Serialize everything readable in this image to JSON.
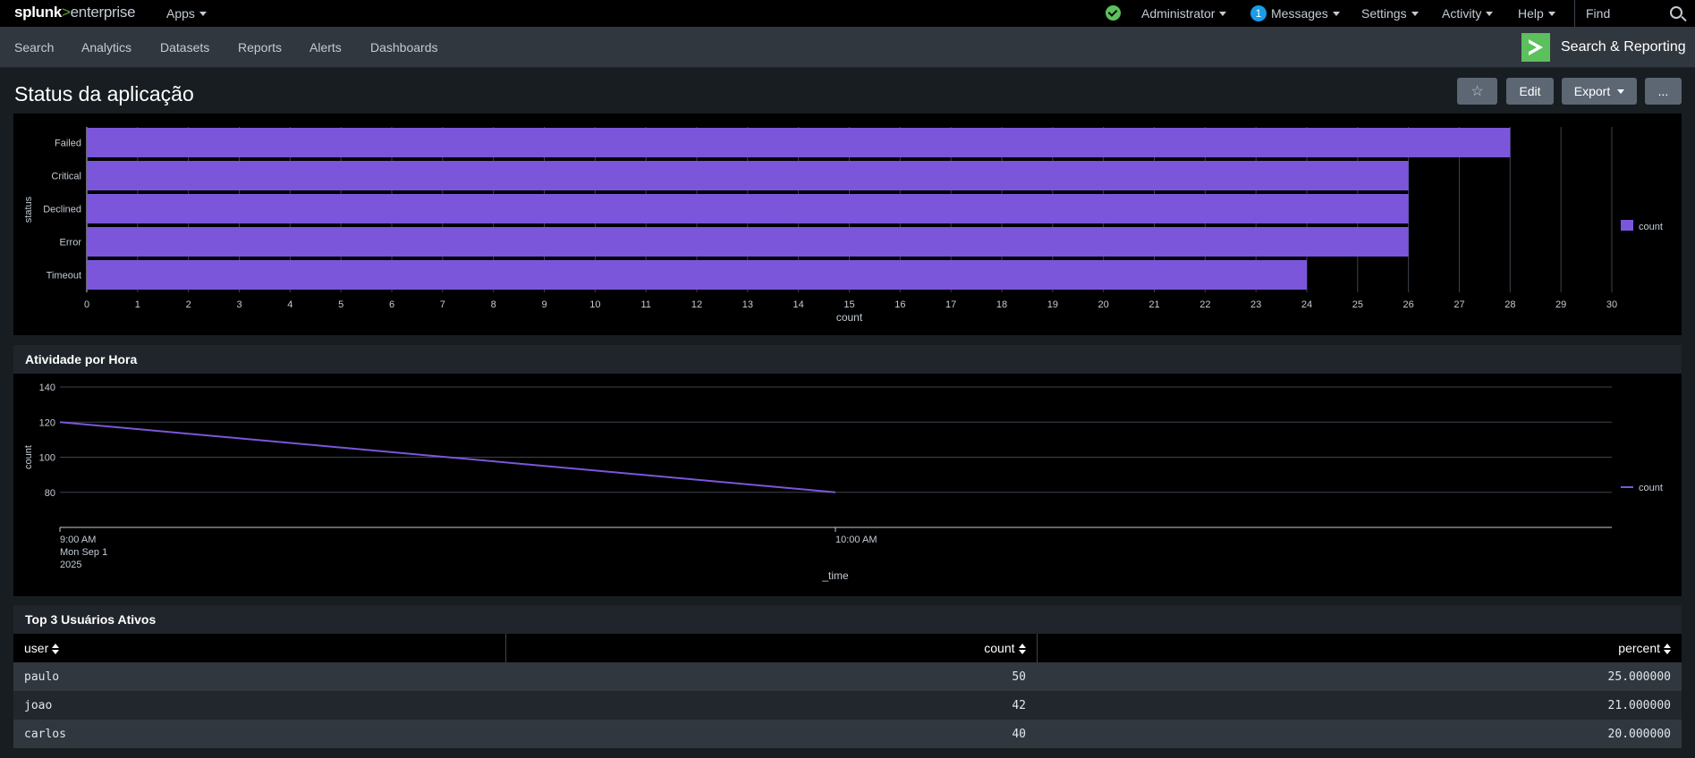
{
  "topbar": {
    "logo_brand": "splunk",
    "logo_gt": ">",
    "logo_product": "enterprise",
    "apps": "Apps",
    "user": "Administrator",
    "messages_count": "1",
    "messages": "Messages",
    "settings": "Settings",
    "activity": "Activity",
    "help": "Help",
    "find": "Find"
  },
  "appbar": {
    "nav": [
      "Search",
      "Analytics",
      "Datasets",
      "Reports",
      "Alerts",
      "Dashboards"
    ],
    "app_title": "Search & Reporting"
  },
  "dashboard": {
    "title": "Status da aplicação",
    "star": "☆",
    "edit": "Edit",
    "export": "Export",
    "more": "..."
  },
  "colors": {
    "series": "#7b56db",
    "background": "#000000",
    "app_green": "#5cc05c"
  },
  "chart_data": [
    {
      "type": "bar",
      "orientation": "horizontal",
      "categories": [
        "Failed",
        "Critical",
        "Declined",
        "Error",
        "Timeout"
      ],
      "series": [
        {
          "name": "count",
          "values": [
            28,
            26,
            26,
            26,
            24
          ]
        }
      ],
      "xlabel": "count",
      "ylabel": "status",
      "xlim": [
        0,
        30
      ],
      "xticks": [
        "0",
        "1",
        "2",
        "3",
        "4",
        "5",
        "6",
        "7",
        "8",
        "9",
        "10",
        "11",
        "12",
        "13",
        "14",
        "15",
        "16",
        "17",
        "18",
        "19",
        "20",
        "21",
        "22",
        "23",
        "24",
        "25",
        "26",
        "27",
        "28",
        "29",
        "30"
      ],
      "grid": true,
      "legend": "right"
    },
    {
      "type": "line",
      "title": "Atividade por Hora",
      "x": [
        "9:00 AM",
        "10:00 AM"
      ],
      "xtick_labels": [
        [
          "9:00 AM",
          "Mon Sep 1",
          "2025"
        ],
        [
          "10:00 AM"
        ]
      ],
      "series": [
        {
          "name": "count",
          "values": [
            120,
            80
          ]
        }
      ],
      "xlabel": "_time",
      "ylabel": "count",
      "ylim": [
        60,
        140
      ],
      "yticks": [
        "80",
        "100",
        "120",
        "140"
      ],
      "grid": true,
      "legend": "right"
    }
  ],
  "table": {
    "title": "Top 3 Usuários Ativos",
    "columns": [
      "user",
      "count",
      "percent"
    ],
    "rows": [
      [
        "paulo",
        "50",
        "25.000000"
      ],
      [
        "joao",
        "42",
        "21.000000"
      ],
      [
        "carlos",
        "40",
        "20.000000"
      ]
    ]
  }
}
